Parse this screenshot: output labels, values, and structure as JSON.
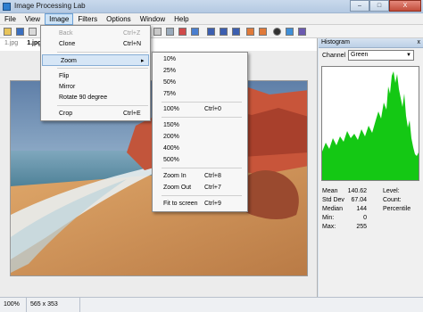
{
  "window": {
    "title": "Image Processing Lab",
    "minimize": "–",
    "maximize": "□",
    "close": "X"
  },
  "menubar": {
    "items": [
      "File",
      "View",
      "Image",
      "Filters",
      "Options",
      "Window",
      "Help"
    ]
  },
  "tabs": [
    "1.jpg",
    "1.jpg"
  ],
  "image_menu": {
    "back": {
      "label": "Back",
      "shortcut": "Ctrl+Z"
    },
    "clone": {
      "label": "Clone",
      "shortcut": "Ctrl+N"
    },
    "zoom": {
      "label": "Zoom",
      "arrow": "▸"
    },
    "flip": {
      "label": "Flip"
    },
    "mirror": {
      "label": "Mirror"
    },
    "rotate": {
      "label": "Rotate 90 degree"
    },
    "crop": {
      "label": "Crop",
      "shortcut": "Ctrl+E"
    }
  },
  "zoom_menu": {
    "p10": "10%",
    "p25": "25%",
    "p50": "50%",
    "p75": "75%",
    "p100": {
      "label": "100%",
      "shortcut": "Ctrl+0"
    },
    "p150": "150%",
    "p200": "200%",
    "p400": "400%",
    "p500": "500%",
    "zoom_in": {
      "label": "Zoom In",
      "shortcut": "Ctrl+8"
    },
    "zoom_out": {
      "label": "Zoom Out",
      "shortcut": "Ctrl+7"
    },
    "fit": {
      "label": "Fit to screen",
      "shortcut": "Ctrl+9"
    }
  },
  "histogram": {
    "title": "Histogram",
    "close": "x",
    "channel_label": "Channel",
    "channel_value": "Green",
    "bar_color": "#14c814",
    "stats": {
      "mean_label": "Mean",
      "mean": "140.62",
      "stddev_label": "Std Dev",
      "stddev": "67.04",
      "median_label": "Median",
      "median": "144",
      "min_label": "Min:",
      "min": "0",
      "max_label": "Max:",
      "max": "255",
      "level_label": "Level:",
      "count_label": "Count:",
      "percentile_label": "Percentile"
    }
  },
  "statusbar": {
    "zoom": "100%",
    "size": "565 x 353"
  }
}
